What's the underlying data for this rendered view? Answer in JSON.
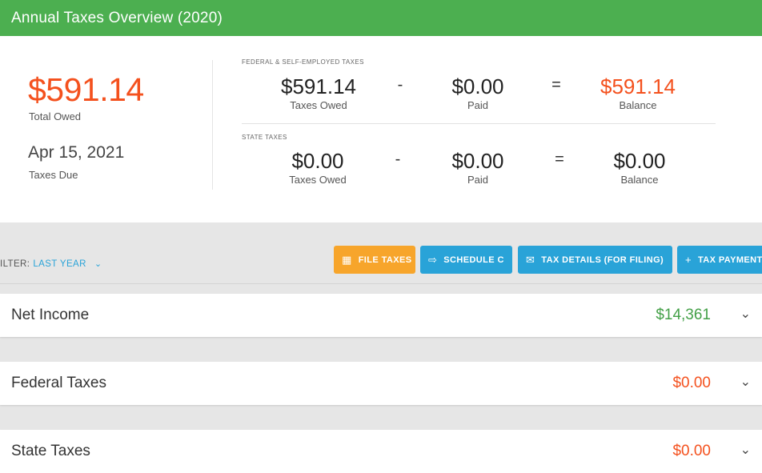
{
  "header": {
    "title": "Annual Taxes Overview (2020)"
  },
  "summary": {
    "total_owed": "$591.14",
    "total_owed_label": "Total Owed",
    "due_date": "Apr 15, 2021",
    "due_label": "Taxes Due",
    "federal": {
      "section_label": "FEDERAL & SELF-EMPLOYED TAXES",
      "owed": "$591.14",
      "owed_label": "Taxes Owed",
      "minus": "-",
      "paid": "$0.00",
      "paid_label": "Paid",
      "equals": "=",
      "balance": "$591.14",
      "balance_label": "Balance"
    },
    "state": {
      "section_label": "STATE TAXES",
      "owed": "$0.00",
      "owed_label": "Taxes Owed",
      "minus": "-",
      "paid": "$0.00",
      "paid_label": "Paid",
      "equals": "=",
      "balance": "$0.00",
      "balance_label": "Balance"
    }
  },
  "toolbar": {
    "filter_label": "ILTER:",
    "filter_value": "LAST YEAR",
    "buttons": {
      "file_taxes": "FILE TAXES",
      "schedule_c": "SCHEDULE C",
      "tax_details": "TAX DETAILS (FOR FILING)",
      "tax_payment": "TAX PAYMENT"
    }
  },
  "rows": [
    {
      "name": "Net Income",
      "value": "$14,361"
    },
    {
      "name": "Federal Taxes",
      "value": "$0.00"
    },
    {
      "name": "State Taxes",
      "value": "$0.00"
    }
  ],
  "colors": {
    "header_green": "#4caf50",
    "accent_orange": "#f4511e",
    "button_orange": "#f7a52b",
    "button_blue": "#29a3d8",
    "income_green": "#43a047"
  },
  "icons": [
    "calendar-icon",
    "export-icon",
    "mail-icon",
    "plus-icon",
    "chevron-down-icon"
  ]
}
